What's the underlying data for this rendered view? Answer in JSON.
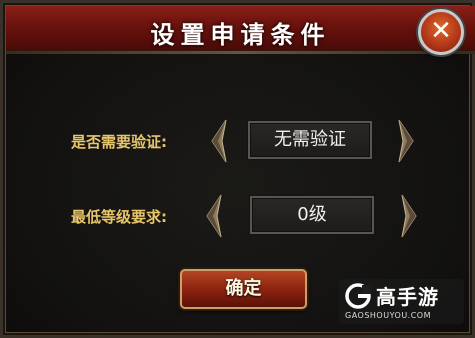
{
  "dialog": {
    "title": "设置申请条件"
  },
  "close_button": {
    "glyph": "✕",
    "icon": "close-icon"
  },
  "verification": {
    "label": "是否需要验证:",
    "value": "无需验证"
  },
  "min_level": {
    "label": "最低等级要求:",
    "value": "0级"
  },
  "confirm_button": {
    "label": "确定"
  },
  "watermark": {
    "name": "高手游",
    "domain": "GAOSHOUYOU.COM",
    "icon": "gaoshouyou-logo"
  },
  "colors": {
    "title_bar": "#6a120d",
    "label_gold": "#e8c66a",
    "button_red": "#8e2411",
    "border_gold": "#c9a066"
  }
}
